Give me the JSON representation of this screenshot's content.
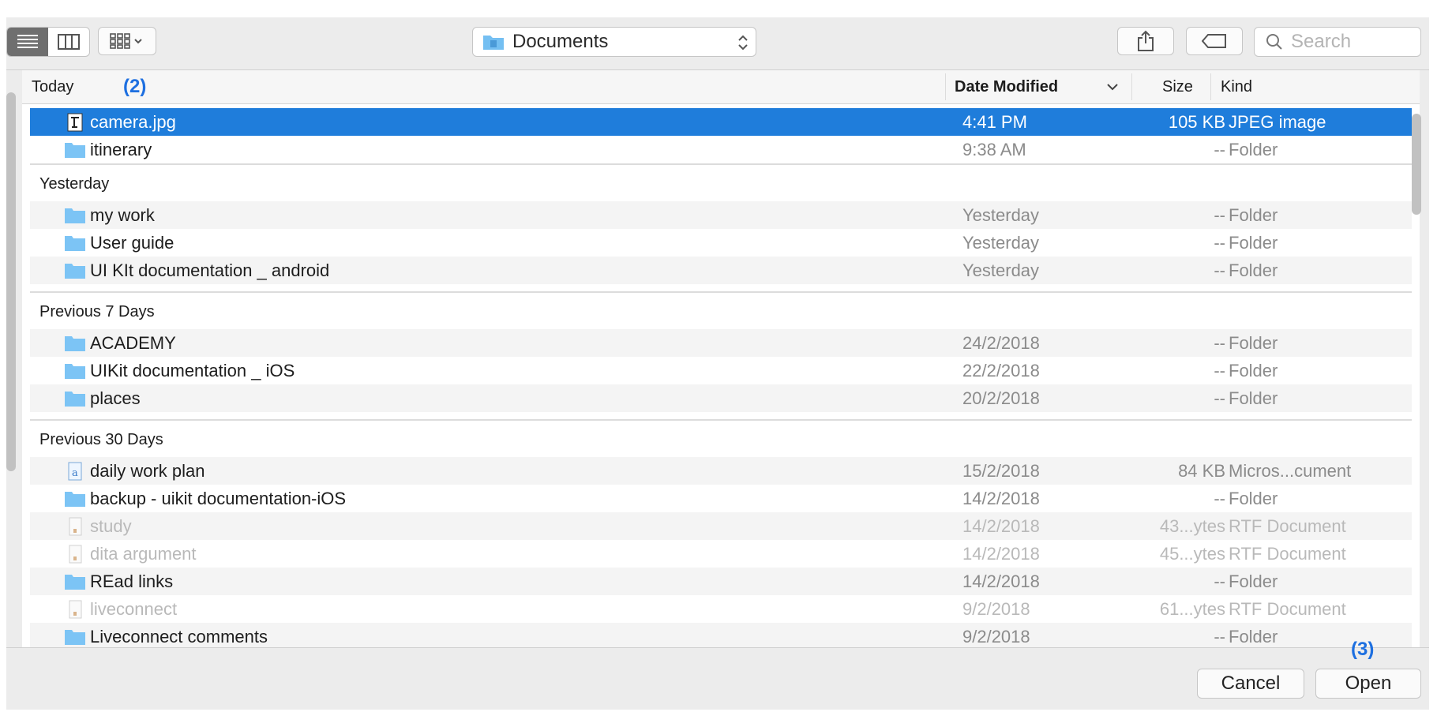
{
  "toolbar": {
    "location": "Documents",
    "search_placeholder": "Search"
  },
  "header": {
    "col_name": "Today",
    "annotation_2": "(2)",
    "col_date": "Date Modified",
    "col_size": "Size",
    "col_kind": "Kind"
  },
  "groups": {
    "yesterday": "Yesterday",
    "prev7": "Previous 7 Days",
    "prev30": "Previous 30 Days"
  },
  "rows": [
    {
      "name": "camera.jpg",
      "date": "4:41 PM",
      "size": "105 KB",
      "kind": "JPEG image",
      "icon": "jpeg-file-icon"
    },
    {
      "name": "itinerary",
      "date": "9:38 AM",
      "size": "--",
      "kind": "Folder",
      "icon": "folder-icon"
    },
    {
      "name": "my work",
      "date": "Yesterday",
      "size": "--",
      "kind": "Folder",
      "icon": "folder-icon"
    },
    {
      "name": "User guide",
      "date": "Yesterday",
      "size": "--",
      "kind": "Folder",
      "icon": "folder-icon"
    },
    {
      "name": "UI KIt documentation _ android",
      "date": "Yesterday",
      "size": "--",
      "kind": "Folder",
      "icon": "folder-icon"
    },
    {
      "name": "ACADEMY",
      "date": "24/2/2018",
      "size": "--",
      "kind": "Folder",
      "icon": "folder-icon"
    },
    {
      "name": "UIKit documentation _ iOS",
      "date": "22/2/2018",
      "size": "--",
      "kind": "Folder",
      "icon": "folder-icon"
    },
    {
      "name": "places",
      "date": "20/2/2018",
      "size": "--",
      "kind": "Folder",
      "icon": "folder-icon"
    },
    {
      "name": "daily work plan",
      "date": "15/2/2018",
      "size": "84 KB",
      "kind": "Micros...cument",
      "icon": "word-document-icon"
    },
    {
      "name": "backup - uikit documentation-iOS",
      "date": "14/2/2018",
      "size": "--",
      "kind": "Folder",
      "icon": "folder-icon"
    },
    {
      "name": "study",
      "date": "14/2/2018",
      "size": "43...ytes",
      "kind": "RTF Document",
      "icon": "rtf-document-icon"
    },
    {
      "name": "dita argument",
      "date": "14/2/2018",
      "size": "45...ytes",
      "kind": "RTF Document",
      "icon": "rtf-document-icon"
    },
    {
      "name": "REad links",
      "date": "14/2/2018",
      "size": "--",
      "kind": "Folder",
      "icon": "folder-icon"
    },
    {
      "name": "liveconnect",
      "date": "9/2/2018",
      "size": "61...ytes",
      "kind": "RTF Document",
      "icon": "rtf-document-icon"
    },
    {
      "name": "Liveconnect comments",
      "date": "9/2/2018",
      "size": "--",
      "kind": "Folder",
      "icon": "folder-icon"
    }
  ],
  "footer": {
    "annotation_3": "(3)",
    "cancel_label": "Cancel",
    "open_label": "Open"
  },
  "colors": {
    "selection": "#1f7ddb",
    "folder": "#7cc4f5",
    "annotation": "#1d6fe0"
  }
}
